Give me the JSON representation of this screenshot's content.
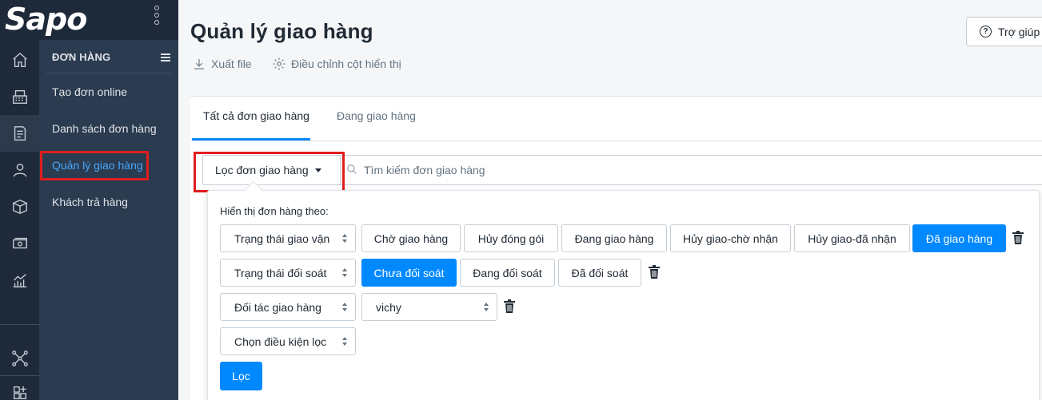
{
  "brand": {
    "logo_text": "Sapo"
  },
  "rail": {
    "icons": [
      "home-icon",
      "cash-register-icon",
      "orders-icon",
      "customer-icon",
      "product-box-icon",
      "cash-icon",
      "report-chart-icon",
      "network-icon",
      "add-app-icon"
    ]
  },
  "menu": {
    "heading": "ĐƠN HÀNG",
    "items": [
      {
        "label": "Tạo đơn online"
      },
      {
        "label": "Danh sách đơn hàng"
      },
      {
        "label": "Quản lý giao hàng"
      },
      {
        "label": "Khách trả hàng"
      }
    ],
    "active_index": 2
  },
  "page": {
    "title": "Quản lý giao hàng",
    "export_label": "Xuất file",
    "columns_label": "Điều chỉnh cột hiển thị",
    "help_label": "Trợ giúp"
  },
  "tabs": [
    {
      "label": "Tất cả đơn giao hàng"
    },
    {
      "label": "Đang giao hàng"
    }
  ],
  "filter": {
    "button_label": "Lọc đơn giao hàng",
    "search_placeholder": "Tìm kiếm đơn giao hàng",
    "popover_label": "Hiển thị đơn hàng theo:",
    "rows": [
      {
        "field": "Trạng thái giao vận",
        "options": [
          "Chờ giao hàng",
          "Hủy đóng gói",
          "Đang giao hàng",
          "Hủy giao-chờ nhận",
          "Hủy giao-đã nhận",
          "Đã giao hàng"
        ],
        "selected": "Đã giao hàng"
      },
      {
        "field": "Trạng thái đối soát",
        "options": [
          "Chưa đối soát",
          "Đang đối soát",
          "Đã đối soát"
        ],
        "selected": "Chưa đối soát"
      },
      {
        "field": "Đối tác giao hàng",
        "value": "vichy"
      },
      {
        "field": "Chọn điều kiện lọc"
      }
    ],
    "apply_label": "Lọc"
  },
  "colors": {
    "sidebar_dark": "#1e2a3a",
    "menu_bg": "#2b3b50",
    "accent": "#0088ff",
    "active_link": "#45a7ff",
    "highlight": "#e01e1e"
  }
}
